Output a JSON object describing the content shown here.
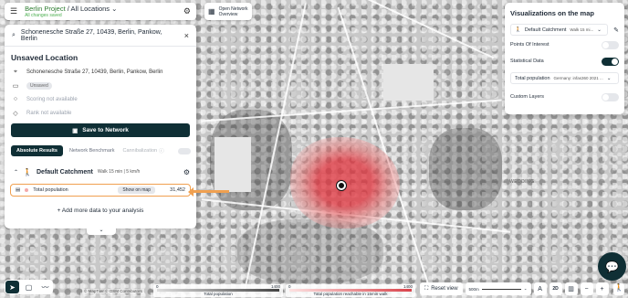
{
  "project": {
    "breadcrumb_project": "Berlin Project",
    "breadcrumb_sep": " / ",
    "breadcrumb_location": "All Locations",
    "status": "All changes saved"
  },
  "overview_button": {
    "line1": "Open Network",
    "line2": "Overview"
  },
  "search": {
    "value": "Schonenesche Straße 27, 10439, Berlin, Pankow, Berlin"
  },
  "location": {
    "title": "Unsaved Location",
    "address": "Schonenesche Straße 27, 10439, Berlin, Pankow, Berlin",
    "badge": "Unsaved",
    "scoring": "Scoring not available",
    "rank": "Rank not available",
    "save_label": "Save to Network"
  },
  "tabs": {
    "absolute": "Absolute Results",
    "benchmark": "Network Benchmark",
    "cannibalization": "Cannibalization"
  },
  "catchment": {
    "title": "Default Catchment",
    "subtitle": "Walk 15 min | 5 km/h"
  },
  "population": {
    "label": "Total population",
    "show_label": "Show on map",
    "value": "31,452"
  },
  "add_data_label": "+ Add more data to your analysis",
  "right_panel": {
    "title": "Visualizations on the map",
    "catchment_select": "Default Catchment",
    "catchment_small": "Walk 15 mi...",
    "points_of_interest": "Points Of Interest",
    "statistical_data": "Statistical Data",
    "stat_select": "Total population",
    "stat_small": "Germany: infas360 2021 ...",
    "custom_layers": "Custom Layers",
    "poi_on": false,
    "stat_on": true,
    "custom_on": false
  },
  "map": {
    "label_wedding": "WEDDING",
    "attribution": "© MapTiler  © OSM Contributors"
  },
  "legend": {
    "left": {
      "min": "0",
      "max": "1400",
      "label": "Total population"
    },
    "right": {
      "min": "0",
      "max": "1400",
      "label": "Total population reachable in 15min walk"
    }
  },
  "bottom": {
    "reset_label": "Reset view",
    "scale_label": "500m",
    "view_mode": "2D"
  },
  "icons": {
    "menu": "hamburger-icon",
    "gear": "gear-icon",
    "search": "search-icon",
    "close": "close-icon",
    "pin": "pin-icon",
    "walk": "walk-icon",
    "chat": "chat-icon"
  }
}
